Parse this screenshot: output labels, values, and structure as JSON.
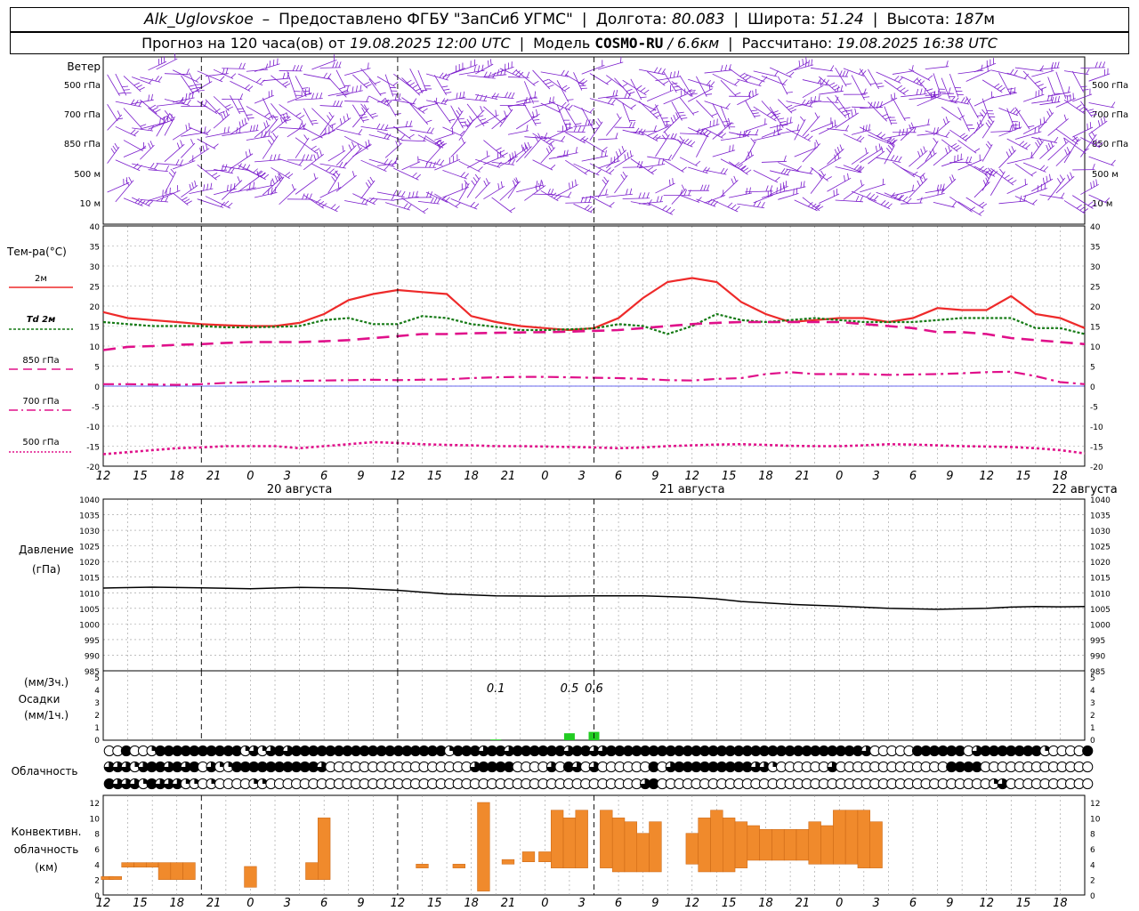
{
  "header": {
    "station": "Alk_Uglovskoe",
    "dash": "–",
    "provider": "Предоставлено ФГБУ \"ЗапСиб УГМС\"",
    "lon_label": "Долгота:",
    "lon_value": "80.083",
    "lat_label": "Широта:",
    "lat_value": "51.24",
    "alt_label": "Высота:",
    "alt_value": "187",
    "alt_unit": "м",
    "forecast_label": "Прогноз на 120 часа(ов) от",
    "forecast_start": "19.08.2025 12:00 UTC",
    "model_label": "Модель",
    "model_name": "COSMO-RU",
    "model_res": "/ 6.6км",
    "computed_label": "Рассчитано:",
    "computed_time": "19.08.2025 16:38 UTC"
  },
  "time_axis": {
    "hour_labels": [
      "12",
      "15",
      "18",
      "21",
      "0",
      "3",
      "6",
      "9",
      "12",
      "15",
      "18",
      "21",
      "0",
      "3",
      "6",
      "9",
      "12",
      "15",
      "18",
      "21",
      "0",
      "3",
      "6",
      "9",
      "12",
      "15",
      "18"
    ],
    "day_labels": [
      {
        "hour_index": 12,
        "text": "20 августа"
      },
      {
        "hour_index": 36,
        "text": "21 августа"
      },
      {
        "hour_index": 60,
        "text": "22 августа"
      }
    ],
    "day_marks": [
      12,
      36,
      60
    ]
  },
  "wind_panel": {
    "title": "Ветер",
    "levels": [
      "500 гПа",
      "700 гПа",
      "850 гПа",
      "500 м",
      "10 м"
    ],
    "color": "#7a1ccc"
  },
  "temperature_panel": {
    "title": "Тем-ра(°C)",
    "legend": [
      "2м",
      "Td 2м",
      "850 гПа",
      "700 гПа",
      "500 гПа"
    ],
    "ticks": [
      "40",
      "35",
      "30",
      "25",
      "20",
      "15",
      "10",
      "5",
      "0",
      "-5",
      "-10",
      "-15",
      "-20"
    ]
  },
  "pressure_panel": {
    "title": "Давление",
    "unit": "(гПа)",
    "ticks": [
      "1040",
      "1035",
      "1030",
      "1025",
      "1020",
      "1015",
      "1010",
      "1005",
      "1000",
      "995",
      "990",
      "985"
    ]
  },
  "precip_panel": {
    "unit_top": "(мм/3ч.)",
    "title": "Осадки",
    "unit_bottom": "(мм/1ч.)",
    "ticks": [
      "5",
      "4",
      "3",
      "2",
      "1",
      "0"
    ],
    "annotations": [
      {
        "hour": 48,
        "text": "0.1"
      },
      {
        "hour": 57,
        "text": "0.5"
      },
      {
        "hour": 60,
        "text": "0.6"
      }
    ],
    "color": "#22cc22"
  },
  "cloud_panel": {
    "title": "Облачность"
  },
  "conv_panel": {
    "title_1": "Конвективн.",
    "title_2": "облачность",
    "unit": "(км)",
    "ticks": [
      "12",
      "10",
      "8",
      "6",
      "4",
      "2",
      "0"
    ],
    "color": "#f08a2c"
  },
  "colors": {
    "t2m": "#ee2a2a",
    "td2m": "#157a15",
    "upper": "#e0108a",
    "pressure": "#000000",
    "zero_line": "#3a3aee"
  },
  "chart_data": [
    {
      "type": "line",
      "title": "Тем-ра(°C)",
      "x_unit": "hours from 19.08.2025 12:00 UTC",
      "ylim": [
        -20,
        40
      ],
      "x": [
        0,
        3,
        6,
        9,
        12,
        15,
        18,
        21,
        24,
        27,
        30,
        33,
        36,
        39,
        42,
        45,
        48,
        51,
        54,
        57,
        60,
        63,
        66,
        69,
        72,
        75,
        78,
        81,
        84,
        87,
        90,
        93,
        96,
        99,
        102,
        105,
        108,
        111,
        114,
        117,
        120
      ],
      "series": [
        {
          "name": "2м",
          "values": [
            18.5,
            17,
            16.5,
            16,
            15.5,
            15.2,
            15,
            15,
            15.8,
            18,
            21.5,
            23,
            24,
            23.5,
            23,
            17.5,
            16,
            15,
            14.5,
            14,
            14.5,
            17,
            22,
            26,
            27,
            26,
            21,
            18,
            16,
            16.5,
            17,
            17,
            16,
            17,
            19.5,
            19,
            19,
            22.5,
            18,
            17,
            14.5
          ]
        },
        {
          "name": "Td 2м",
          "values": [
            16,
            15.5,
            15,
            15,
            15,
            14.7,
            14.7,
            14.8,
            15,
            16.5,
            17,
            15.5,
            15.5,
            17.5,
            17,
            15.5,
            14.8,
            14,
            14,
            14.2,
            14.4,
            15.5,
            15,
            13,
            15,
            18,
            16.5,
            16,
            16.5,
            17,
            16.5,
            16,
            16,
            16,
            16.5,
            17,
            17,
            17,
            14.5,
            14.5,
            13
          ]
        },
        {
          "name": "850 гПа",
          "values": [
            9,
            9.8,
            10,
            10.3,
            10.5,
            10.8,
            11,
            11,
            11,
            11.2,
            11.5,
            12,
            12.5,
            13,
            13,
            13.2,
            13.3,
            13.4,
            13.5,
            13.6,
            13.8,
            14,
            14.5,
            15,
            15.5,
            15.8,
            16,
            16,
            16,
            16,
            16,
            15.5,
            15,
            14.5,
            13.5,
            13.5,
            13,
            12,
            11.5,
            11,
            10.5
          ]
        },
        {
          "name": "700 гПа",
          "values": [
            0.5,
            0.5,
            0.4,
            0.3,
            0.5,
            0.8,
            1,
            1.2,
            1.3,
            1.4,
            1.5,
            1.6,
            1.5,
            1.6,
            1.7,
            2,
            2.2,
            2.3,
            2.3,
            2.2,
            2.1,
            2,
            1.8,
            1.5,
            1.4,
            1.8,
            2,
            3,
            3.5,
            3,
            3,
            3,
            2.8,
            2.9,
            3,
            3.2,
            3.5,
            3.6,
            2.5,
            1,
            0.5
          ]
        },
        {
          "name": "500 гПа",
          "values": [
            -17,
            -16.5,
            -16,
            -15.5,
            -15.3,
            -15,
            -15,
            -15,
            -15.5,
            -15,
            -14.5,
            -14,
            -14.2,
            -14.5,
            -14.7,
            -14.8,
            -15,
            -15,
            -15.1,
            -15.2,
            -15.3,
            -15.5,
            -15.3,
            -15,
            -14.8,
            -14.6,
            -14.5,
            -14.7,
            -14.9,
            -15,
            -15,
            -14.8,
            -14.5,
            -14.6,
            -14.8,
            -15,
            -15.1,
            -15.2,
            -15.5,
            -16,
            -16.8
          ]
        }
      ]
    },
    {
      "type": "line",
      "title": "Давление",
      "ylabel": "(гПа)",
      "ylim": [
        985,
        1040
      ],
      "x": [
        0,
        6,
        12,
        18,
        24,
        30,
        36,
        42,
        48,
        54,
        60,
        66,
        72,
        75,
        78,
        84,
        90,
        96,
        102,
        108,
        111,
        114,
        117,
        120
      ],
      "series": [
        {
          "name": "Давление",
          "values": [
            1011.5,
            1011.8,
            1011.6,
            1011.3,
            1011.7,
            1011.5,
            1010.8,
            1009.6,
            1009,
            1008.9,
            1009,
            1009,
            1008.5,
            1008,
            1007.2,
            1006.3,
            1005.7,
            1005,
            1004.7,
            1005,
            1005.4,
            1005.6,
            1005.5,
            1005.6
          ]
        }
      ]
    },
    {
      "type": "bar",
      "title": "Осадки",
      "ylim": [
        0,
        5
      ],
      "bars": [
        {
          "hour": 48,
          "value": 0.05
        },
        {
          "hour": 57,
          "value": 0.5
        },
        {
          "hour": 60,
          "value": 0.6
        }
      ]
    },
    {
      "type": "bar",
      "title": "Конвективн. облачность",
      "ylabel": "(км)",
      "ylim": [
        0,
        12
      ],
      "layers": [
        {
          "hour": 0.5,
          "bottom": 2,
          "top": 2.4
        },
        {
          "hour": 1.5,
          "bottom": 2,
          "top": 2.4
        },
        {
          "hour": 3,
          "bottom": 3.6,
          "top": 4.2
        },
        {
          "hour": 4.5,
          "bottom": 3.6,
          "top": 4.2
        },
        {
          "hour": 6,
          "bottom": 3.6,
          "top": 4.2
        },
        {
          "hour": 7.5,
          "bottom": 2,
          "top": 4.2
        },
        {
          "hour": 9,
          "bottom": 2,
          "top": 4.2
        },
        {
          "hour": 10.5,
          "bottom": 2,
          "top": 4.2
        },
        {
          "hour": 18,
          "bottom": 1,
          "top": 3.7
        },
        {
          "hour": 25.5,
          "bottom": 2,
          "top": 4.2
        },
        {
          "hour": 27,
          "bottom": 2,
          "top": 10
        },
        {
          "hour": 39,
          "bottom": 3.5,
          "top": 4
        },
        {
          "hour": 43.5,
          "bottom": 3.5,
          "top": 4
        },
        {
          "hour": 46.5,
          "bottom": 0.5,
          "top": 12
        },
        {
          "hour": 49.5,
          "bottom": 4,
          "top": 4.6
        },
        {
          "hour": 52,
          "bottom": 4.3,
          "top": 5.6
        },
        {
          "hour": 54,
          "bottom": 4.3,
          "top": 5.6
        },
        {
          "hour": 55.5,
          "bottom": 3.5,
          "top": 11
        },
        {
          "hour": 57,
          "bottom": 3.5,
          "top": 10
        },
        {
          "hour": 58.5,
          "bottom": 3.5,
          "top": 11
        },
        {
          "hour": 61.5,
          "bottom": 3.5,
          "top": 11
        },
        {
          "hour": 63,
          "bottom": 3,
          "top": 10
        },
        {
          "hour": 64.5,
          "bottom": 3,
          "top": 9.5
        },
        {
          "hour": 66,
          "bottom": 3,
          "top": 8
        },
        {
          "hour": 67.5,
          "bottom": 3,
          "top": 9.5
        },
        {
          "hour": 72,
          "bottom": 4,
          "top": 8
        },
        {
          "hour": 73.5,
          "bottom": 3,
          "top": 10
        },
        {
          "hour": 75,
          "bottom": 3,
          "top": 11
        },
        {
          "hour": 76.5,
          "bottom": 3,
          "top": 10
        },
        {
          "hour": 78,
          "bottom": 3.5,
          "top": 9.5
        },
        {
          "hour": 79.5,
          "bottom": 4.5,
          "top": 9
        },
        {
          "hour": 81,
          "bottom": 4.5,
          "top": 8.5
        },
        {
          "hour": 82.5,
          "bottom": 4.5,
          "top": 8.5
        },
        {
          "hour": 84,
          "bottom": 4.5,
          "top": 8.5
        },
        {
          "hour": 85.5,
          "bottom": 4.5,
          "top": 8.5
        },
        {
          "hour": 87,
          "bottom": 4,
          "top": 9.5
        },
        {
          "hour": 88.5,
          "bottom": 4,
          "top": 9
        },
        {
          "hour": 90,
          "bottom": 4,
          "top": 11
        },
        {
          "hour": 91.5,
          "bottom": 4,
          "top": 11
        },
        {
          "hour": 93,
          "bottom": 3.5,
          "top": 11
        },
        {
          "hour": 94.5,
          "bottom": 3.5,
          "top": 9.5
        }
      ]
    }
  ],
  "cloud_rows": [
    [
      0,
      0,
      4,
      0,
      0,
      2,
      4,
      4,
      4,
      4,
      4,
      4,
      4,
      4,
      4,
      4,
      2,
      3,
      2,
      3,
      4,
      3,
      4,
      4,
      4,
      4,
      4,
      4,
      4,
      4,
      4,
      4,
      4,
      4,
      4,
      4,
      4,
      4,
      4,
      4,
      2,
      4,
      4,
      4,
      3,
      4,
      4,
      3,
      4,
      4,
      4,
      4,
      4,
      4,
      3,
      4,
      4,
      3,
      3,
      4,
      4,
      4,
      4,
      4,
      4,
      4,
      4,
      4,
      4,
      4,
      4,
      4,
      4,
      4,
      4,
      4,
      4,
      4,
      4,
      4,
      4,
      4,
      4,
      4,
      4,
      4,
      4,
      4,
      4,
      3,
      0,
      0,
      0,
      0,
      0,
      4,
      4,
      4,
      4,
      4,
      4,
      0,
      3,
      4,
      4,
      4,
      4,
      4,
      4,
      4,
      2,
      0,
      0,
      0,
      0,
      4
    ],
    [
      3,
      3,
      3,
      2,
      3,
      4,
      4,
      3,
      4,
      3,
      4,
      0,
      3,
      2,
      2,
      4,
      4,
      4,
      4,
      4,
      4,
      4,
      4,
      4,
      4,
      3,
      0,
      0,
      0,
      0,
      0,
      0,
      0,
      0,
      0,
      0,
      0,
      0,
      0,
      0,
      0,
      0,
      0,
      3,
      4,
      4,
      4,
      4,
      0,
      0,
      0,
      0,
      3,
      0,
      4,
      3,
      0,
      3,
      0,
      0,
      0,
      0,
      0,
      0,
      4,
      0,
      3,
      4,
      4,
      4,
      4,
      4,
      4,
      4,
      4,
      4,
      3,
      3,
      2,
      0,
      0,
      0,
      0,
      0,
      0,
      3,
      0,
      0,
      0,
      0,
      0,
      0,
      0,
      0,
      0,
      0,
      0,
      0,
      0,
      4,
      4,
      4,
      4,
      0,
      0,
      0,
      0,
      0,
      0,
      0,
      0,
      0,
      0,
      0,
      0,
      0
    ],
    [
      4,
      3,
      3,
      3,
      2,
      4,
      3,
      3,
      3,
      2,
      2,
      0,
      2,
      0,
      0,
      0,
      0,
      2,
      2,
      0,
      0,
      0,
      0,
      0,
      0,
      0,
      0,
      0,
      0,
      0,
      0,
      0,
      0,
      0,
      0,
      0,
      0,
      0,
      0,
      0,
      0,
      0,
      0,
      0,
      0,
      0,
      0,
      0,
      0,
      0,
      0,
      0,
      0,
      0,
      0,
      0,
      0,
      0,
      0,
      0,
      0,
      0,
      0,
      3,
      4,
      0,
      0,
      0,
      0,
      0,
      0,
      0,
      0,
      0,
      0,
      0,
      0,
      0,
      0,
      0,
      0,
      0,
      0,
      0,
      0,
      0,
      0,
      0,
      0,
      0,
      0,
      0,
      0,
      0,
      0,
      0,
      0,
      0,
      0,
      0,
      0,
      0,
      0,
      0,
      2,
      3,
      0,
      0,
      0,
      0,
      0,
      0,
      0,
      0,
      0,
      0
    ]
  ]
}
